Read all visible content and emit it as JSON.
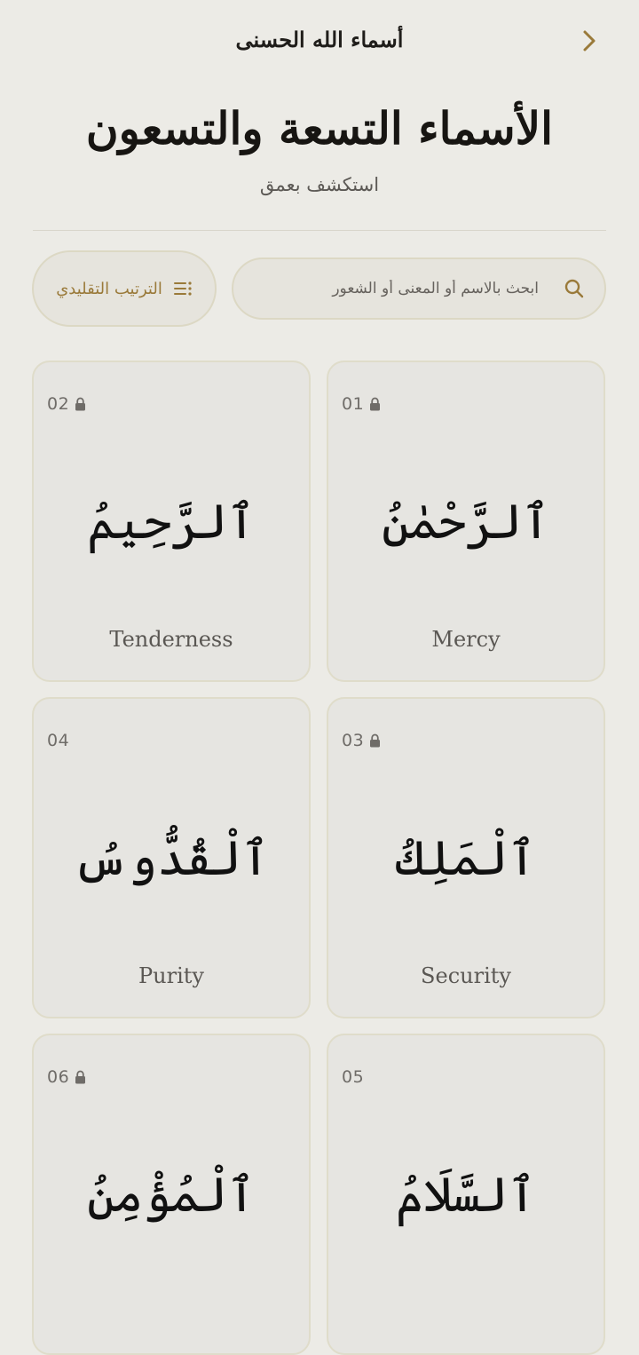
{
  "header": {
    "title": "أسماء الله الحسنى",
    "back_icon": "chevron-right-icon"
  },
  "hero": {
    "title": "الأسماء التسعة والتسعون",
    "subtitle": "استكشف بعمق"
  },
  "controls": {
    "sort_label": "الترتيب التقليدي",
    "sort_icon": "list-icon",
    "search_placeholder": "ابحث بالاسم أو المعنى أو الشعور",
    "search_value": "",
    "search_icon": "search-icon"
  },
  "colors": {
    "accent": "#9a7a3a",
    "background": "#ecebe6",
    "card": "#e6e5e1",
    "border": "#dfdcca"
  },
  "names": [
    {
      "number": "01",
      "arabic": "ٱلرَّحْمٰنُ",
      "meaning": "Mercy",
      "locked": true
    },
    {
      "number": "02",
      "arabic": "ٱلرَّحِيمُ",
      "meaning": "Tenderness",
      "locked": true
    },
    {
      "number": "03",
      "arabic": "ٱلْمَلِكُ",
      "meaning": "Security",
      "locked": true
    },
    {
      "number": "04",
      "arabic": "ٱلْقُدُّوسُ",
      "meaning": "Purity",
      "locked": false
    },
    {
      "number": "05",
      "arabic": "ٱلسَّلَامُ",
      "meaning": "",
      "locked": false
    },
    {
      "number": "06",
      "arabic": "ٱلْمُؤْمِنُ",
      "meaning": "",
      "locked": true
    }
  ]
}
